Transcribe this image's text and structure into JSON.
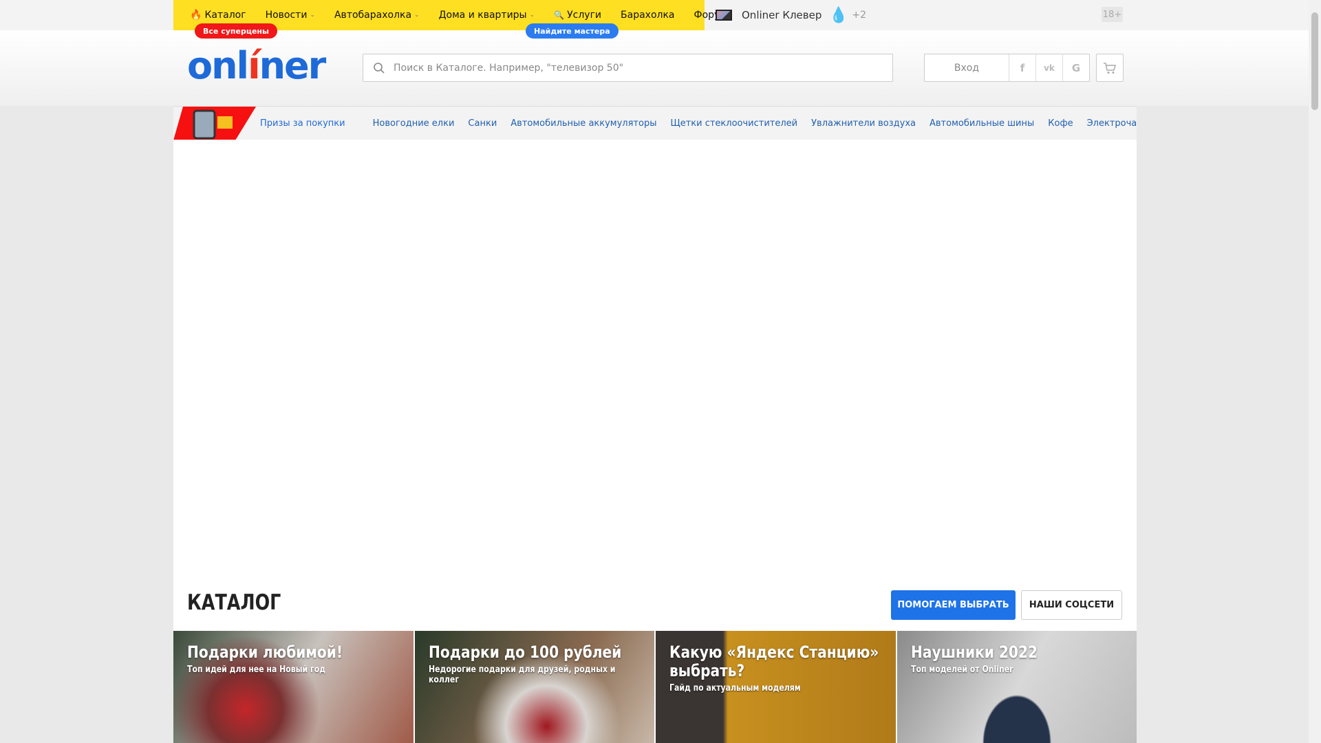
{
  "topbar": {
    "items": [
      {
        "label": "Каталог",
        "icon": "flame-icon"
      },
      {
        "label": "Новости",
        "dropdown": true
      },
      {
        "label": "Автобарахолка",
        "dropdown": true
      },
      {
        "label": "Дома и квартиры",
        "dropdown": true
      },
      {
        "label": "Услуги",
        "icon": "search-icon"
      },
      {
        "label": "Барахолка"
      },
      {
        "label": "Форум"
      }
    ],
    "badge_catalog": "Все суперцены",
    "badge_services": "Найдите мастера",
    "klever": "Onliner Клевер",
    "weather": "+2",
    "age": "18+"
  },
  "header": {
    "logo": "onliner",
    "search_placeholder": "Поиск в Каталоге. Например, \"телевизор 50\"",
    "login": "Вход",
    "social": [
      "f",
      "vk",
      "G"
    ]
  },
  "nav": {
    "promo": "Призы за покупки",
    "links": [
      "Новогодние елки",
      "Санки",
      "Автомобильные аккумуляторы",
      "Щетки стеклоочистителей",
      "Увлажнители воздуха",
      "Автомобильные шины",
      "Кофе",
      "Электрочайники и термопоты"
    ]
  },
  "catalog": {
    "title": "КАТАЛОГ",
    "help_button": "ПОМОГАЕМ ВЫБРАТЬ",
    "social_button": "НАШИ СОЦСЕТИ",
    "cards": [
      {
        "title": "Подарки любимой!",
        "subtitle": "Топ идей для нее на Новый год"
      },
      {
        "title": "Подарки до 100 рублей",
        "subtitle": "Недорогие подарки для друзей, родных и коллег"
      },
      {
        "title": "Какую «Яндекс Станцию» выбрать?",
        "subtitle": "Гайд по актуальным моделям"
      },
      {
        "title": "Наушники 2022",
        "subtitle": "Топ моделей от Onliner"
      }
    ]
  },
  "colors": {
    "yellow": "#ffdf22",
    "brand_blue": "#1e6ad8",
    "red": "#ff1a1a",
    "button_blue": "#1e73e8"
  }
}
